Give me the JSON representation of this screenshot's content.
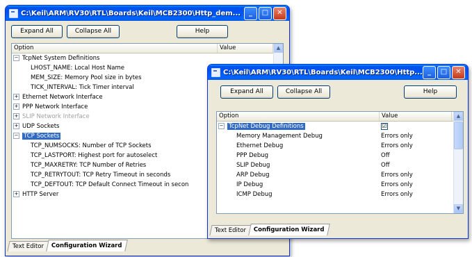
{
  "back_window": {
    "title": "C:\\Keil\\ARM\\RV30\\RTL\\Boards\\Keil\\MCB2300\\Http_dem...",
    "buttons": {
      "expand_all": "Expand All",
      "collapse_all": "Collapse All",
      "help": "Help"
    },
    "columns": {
      "option": "Option",
      "value": "Value"
    },
    "rows": [
      {
        "label": "TcpNet System Definitions",
        "expander": "−"
      },
      {
        "label": "LHOST_NAME: Local Host Name"
      },
      {
        "label": "MEM_SIZE: Memory Pool size in bytes"
      },
      {
        "label": "TICK_INTERVAL: Tick Timer interval"
      },
      {
        "label": "Ethernet Network Interface",
        "expander": "+"
      },
      {
        "label": "PPP Network Interface",
        "expander": "+"
      },
      {
        "label": "SLIP Network Interface",
        "expander": "+"
      },
      {
        "label": "UDP Sockets",
        "expander": "+"
      },
      {
        "label": "TCP Sockets",
        "expander": "−"
      },
      {
        "label": "TCP_NUMSOCKS: Number of TCP Sockets"
      },
      {
        "label": "TCP_LASTPORT: Highest port for autoselect"
      },
      {
        "label": "TCP_MAXRETRY: TCP Number of Retries"
      },
      {
        "label": "TCP_RETRYTOUT: TCP Retry Timeout in seconds"
      },
      {
        "label": "TCP_DEFTOUT: TCP Default Connect Timeout in secon"
      },
      {
        "label": "HTTP Server",
        "expander": "+"
      }
    ],
    "tabs": {
      "text_editor": "Text Editor",
      "config_wizard": "Configuration Wizard"
    }
  },
  "front_window": {
    "title": "C:\\Keil\\ARM\\RV30\\RTL\\Boards\\Keil\\MCB2300\\Http...",
    "buttons": {
      "expand_all": "Expand All",
      "collapse_all": "Collapse All",
      "help": "Help"
    },
    "columns": {
      "option": "Option",
      "value": "Value"
    },
    "rows": [
      {
        "label": "TcpNet Debug Definitions",
        "expander": "−",
        "value": "☑"
      },
      {
        "label": "Memory Management Debug",
        "value": "Errors only"
      },
      {
        "label": "Ethernet Debug",
        "value": "Errors only"
      },
      {
        "label": "PPP Debug",
        "value": "Off"
      },
      {
        "label": "SLIP Debug",
        "value": "Off"
      },
      {
        "label": "ARP Debug",
        "value": "Errors only"
      },
      {
        "label": "IP Debug",
        "value": "Errors only"
      },
      {
        "label": "ICMP Debug",
        "value": "Errors only"
      }
    ],
    "tabs": {
      "text_editor": "Text Editor",
      "config_wizard": "Configuration Wizard"
    }
  },
  "titlebar_controls": {
    "minimize": "_",
    "maximize": "□",
    "close": "✕"
  },
  "scroll_arrows": {
    "up": "▲",
    "down": "▼"
  },
  "colors": {
    "titlebar": "#0055e5",
    "selection": "#316ac5",
    "window_face": "#ece9d8"
  }
}
